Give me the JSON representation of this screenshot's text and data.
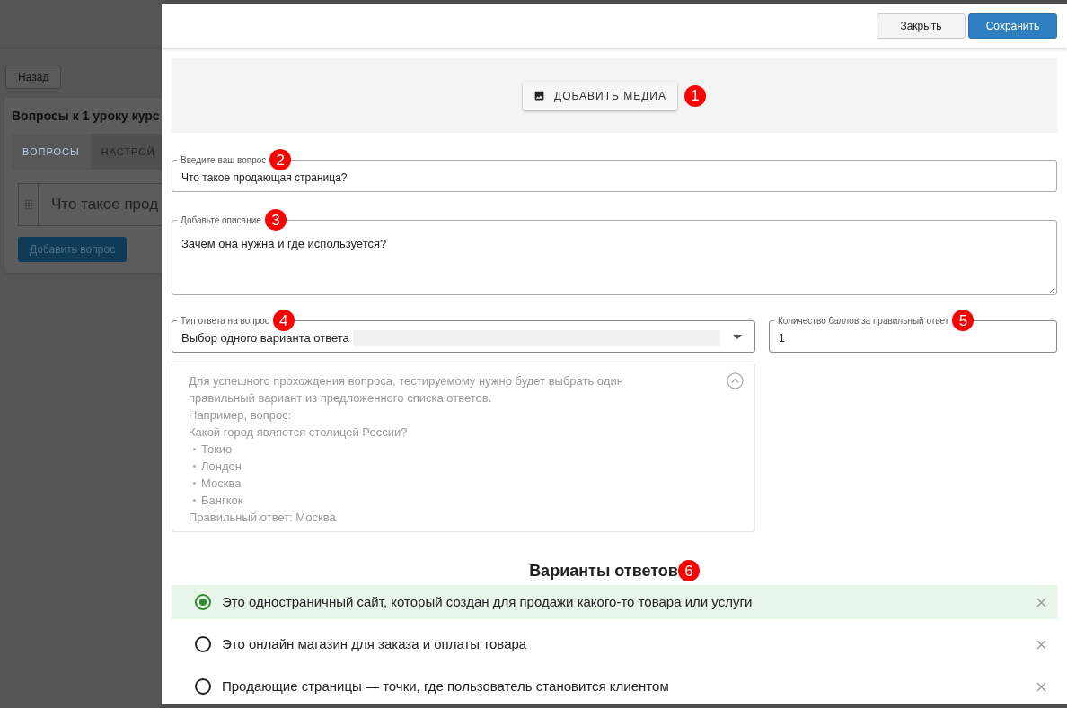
{
  "background_page": {
    "back_button": "Назад",
    "card_title": "Вопросы к 1 уроку курс",
    "tabs": [
      {
        "label": "ВОПРОСЫ",
        "selected": true
      },
      {
        "label": "НАСТРОЙ",
        "selected": false
      }
    ],
    "question_row": "Что такое прод",
    "add_button": "Добавить вопрос"
  },
  "drawer": {
    "buttons": [
      {
        "label": "Закрыть",
        "kind": "secondary"
      },
      {
        "label": "Сохранить",
        "kind": "primary"
      }
    ],
    "media_button": {
      "label": "ДОБАВИТЬ МЕДИА",
      "marker": "1"
    },
    "question": {
      "label": "Введите ваш вопрос",
      "value": "Что такое продающая страница?",
      "marker": "2"
    },
    "description": {
      "label": "Добавьте описание",
      "value": "Зачем она нужна и где используется?",
      "marker": "3"
    },
    "answer_type": {
      "label": "Тип ответа на вопрос",
      "value": "Выбор одного варианта ответа",
      "marker": "4"
    },
    "points": {
      "label": "Количество баллов за правильный ответ",
      "value": "1",
      "marker": "5"
    },
    "info": {
      "expanded": true,
      "lines": [
        {
          "kind": "text",
          "text": "Для успешного прохождения вопроса, тестируемому нужно будет выбрать один"
        },
        {
          "kind": "text",
          "text": "правильный вариант из предложенного списка ответов."
        },
        {
          "kind": "text",
          "text": "Например, вопрос:"
        },
        {
          "kind": "text",
          "text": "Какой город является столицей России?"
        },
        {
          "kind": "bullet",
          "text": "Токио"
        },
        {
          "kind": "bullet",
          "text": "Лондон"
        },
        {
          "kind": "bullet",
          "text": "Москва"
        },
        {
          "kind": "bullet",
          "text": "Бангкок"
        },
        {
          "kind": "text",
          "text": "Правильный ответ: Москва"
        }
      ]
    },
    "answers_title": "Варианты ответов",
    "answers_marker": "6",
    "answers": [
      {
        "text": "Это одностраничный сайт, который создан для продажи какого-то товара или услуги",
        "selected": true
      },
      {
        "text": "Это онлайн магазин для заказа и оплаты товара",
        "selected": false
      },
      {
        "text": "Продающие страницы — точки, где пользователь становится клиентом",
        "selected": false
      }
    ]
  }
}
